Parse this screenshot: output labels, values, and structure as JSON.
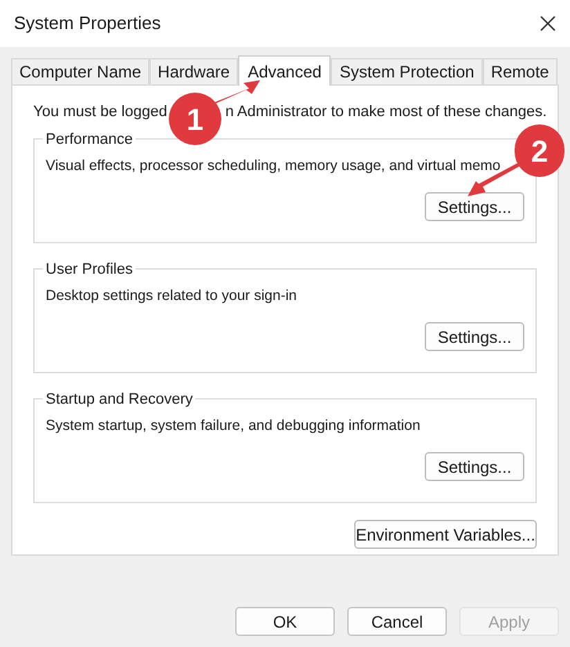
{
  "window": {
    "title": "System Properties"
  },
  "tabs": [
    {
      "label": "Computer Name",
      "selected": false
    },
    {
      "label": "Hardware",
      "selected": false
    },
    {
      "label": "Advanced",
      "selected": true
    },
    {
      "label": "System Protection",
      "selected": false
    },
    {
      "label": "Remote",
      "selected": false
    }
  ],
  "notice": [
    "You must be logged",
    "n Administrator to make most of these changes."
  ],
  "groups": [
    {
      "title": "Performance",
      "description": "Visual effects, processor scheduling, memory usage, and virtual memo",
      "button": "Settings..."
    },
    {
      "title": "User Profiles",
      "description": "Desktop settings related to your sign-in",
      "button": "Settings..."
    },
    {
      "title": "Startup and Recovery",
      "description": "System startup, system failure, and debugging information",
      "button": "Settings..."
    }
  ],
  "environment_button": "Environment Variables...",
  "buttons": [
    {
      "label": "OK",
      "disabled": false
    },
    {
      "label": "Cancel",
      "disabled": false
    },
    {
      "label": "Apply",
      "disabled": true
    }
  ],
  "annotations": [
    "1",
    "2"
  ]
}
